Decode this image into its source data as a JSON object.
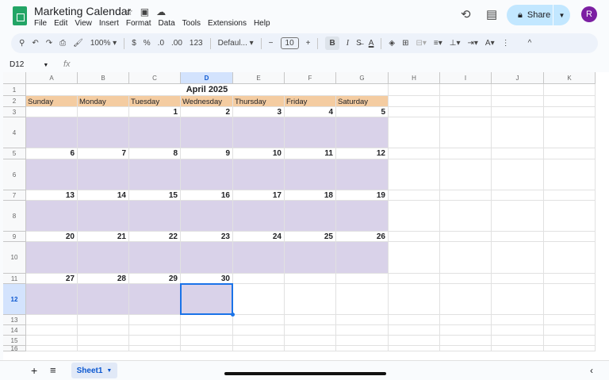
{
  "app": {
    "title": "Marketing Calendar",
    "menu": [
      "File",
      "Edit",
      "View",
      "Insert",
      "Format",
      "Data",
      "Tools",
      "Extensions",
      "Help"
    ],
    "share_label": "Share",
    "avatar_letter": "R"
  },
  "toolbar": {
    "zoom": "100%",
    "currency": "$",
    "percent": "%",
    "dec_decrease": ".0",
    "dec_increase": ".00",
    "number_format": "123",
    "font": "Defaul...",
    "font_size": "10",
    "bold": "B",
    "italic": "I"
  },
  "formula_bar": {
    "name_box": "D12",
    "fx": "fx",
    "value": ""
  },
  "columns": [
    "A",
    "B",
    "C",
    "D",
    "E",
    "F",
    "G",
    "H",
    "I",
    "J",
    "K"
  ],
  "rows": [
    "1",
    "2",
    "3",
    "4",
    "5",
    "6",
    "7",
    "8",
    "9",
    "10",
    "11",
    "12",
    "13",
    "14",
    "15",
    "16"
  ],
  "selected_cell": "D12",
  "colors": {
    "header_fill": "#f4cca1",
    "body_fill": "#d9d2e9",
    "accent": "#1a73e8"
  },
  "calendar": {
    "title": "April 2025",
    "weekdays": [
      "Sunday",
      "Monday",
      "Tuesday",
      "Wednesday",
      "Thursday",
      "Friday",
      "Saturday"
    ],
    "weeks": [
      [
        "",
        "",
        "1",
        "2",
        "3",
        "4",
        "5"
      ],
      [
        "6",
        "7",
        "8",
        "9",
        "10",
        "11",
        "12"
      ],
      [
        "13",
        "14",
        "15",
        "16",
        "17",
        "18",
        "19"
      ],
      [
        "20",
        "21",
        "22",
        "23",
        "24",
        "25",
        "26"
      ],
      [
        "27",
        "28",
        "29",
        "30",
        "",
        "",
        ""
      ]
    ]
  },
  "sheets": [
    {
      "name": "Sheet1",
      "active": true
    }
  ]
}
